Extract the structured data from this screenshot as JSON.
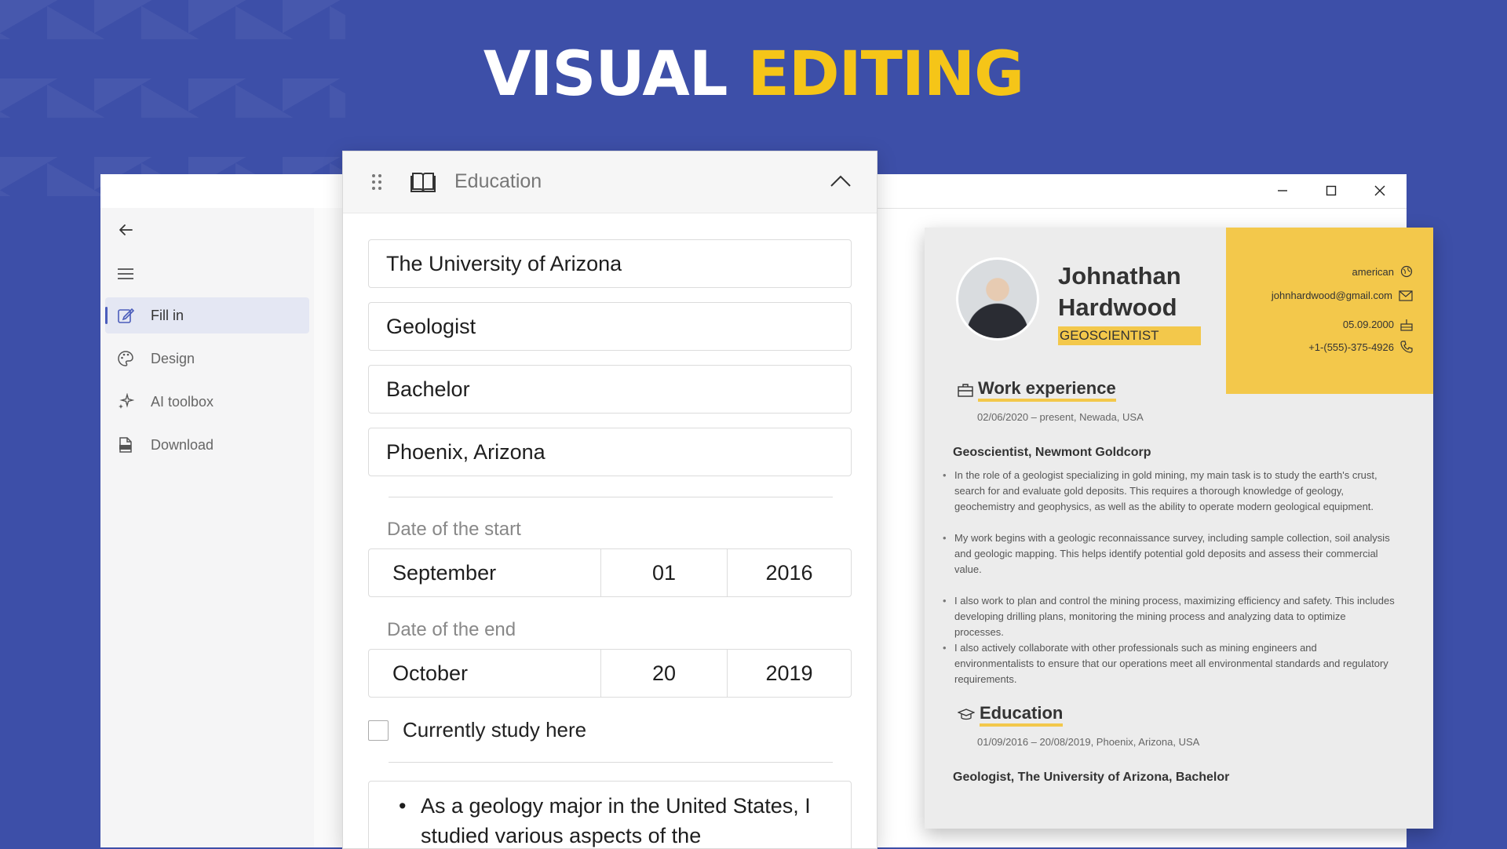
{
  "hero": {
    "white": "VISUAL",
    "yellow": "EDITING"
  },
  "colors": {
    "background": "#3d4fa8",
    "accent_yellow": "#f5c518",
    "resume_yellow": "#f3c84b",
    "nav_active": "#4b5dbb"
  },
  "sidebar": {
    "items": [
      {
        "label": "Fill in",
        "icon": "edit-icon",
        "active": true
      },
      {
        "label": "Design",
        "icon": "palette-icon"
      },
      {
        "label": "AI toolbox",
        "icon": "sparkle-icon"
      },
      {
        "label": "Download",
        "icon": "pdf-icon"
      }
    ]
  },
  "panel": {
    "title": "Education",
    "university": "The University of Arizona",
    "position": "Geologist",
    "degree": "Bachelor",
    "location": "Phoenix, Arizona",
    "start_label": "Date of the start",
    "start": {
      "month": "September",
      "day": "01",
      "year": "2016"
    },
    "end_label": "Date of the end",
    "end": {
      "month": "October",
      "day": "20",
      "year": "2019"
    },
    "current_label": "Currently study here",
    "current_checked": false,
    "description_text": "As a geology major in the United States, I studied various aspects of the"
  },
  "resume": {
    "name_line1": "Johnathan",
    "name_line2": "Hardwood",
    "role": "GEOSCIENTIST",
    "contacts": {
      "nationality": "american",
      "email": "johnhardwood@gmail.com",
      "birthday": "05.09.2000",
      "phone": "+1-(555)-375-4926"
    },
    "work": {
      "title": "Work experience",
      "dates": "02/06/2020 – present, Newada, USA",
      "job": "Geoscientist, Newmont Goldcorp",
      "bullets": [
        "In the role of a geologist specializing in gold mining, my main task is to study the earth's crust, search for and evaluate gold deposits. This requires a thorough knowledge of geology, geochemistry and geophysics, as well as the ability to operate modern geological equipment.",
        "My work begins with a geologic reconnaissance survey, including sample collection, soil analysis and geologic mapping. This helps identify potential gold deposits and assess their commercial value.",
        "I also work to plan and control the mining process, maximizing efficiency and safety. This includes developing drilling plans, monitoring the mining process and analyzing data to optimize processes.",
        "I also actively collaborate with other professionals such as mining engineers and environmentalists to ensure that our operations meet all environmental standards and regulatory requirements."
      ]
    },
    "education": {
      "title": "Education",
      "dates": "01/09/2016 – 20/08/2019, Phoenix, Arizona, USA",
      "entry": "Geologist, The University of Arizona, Bachelor"
    }
  }
}
